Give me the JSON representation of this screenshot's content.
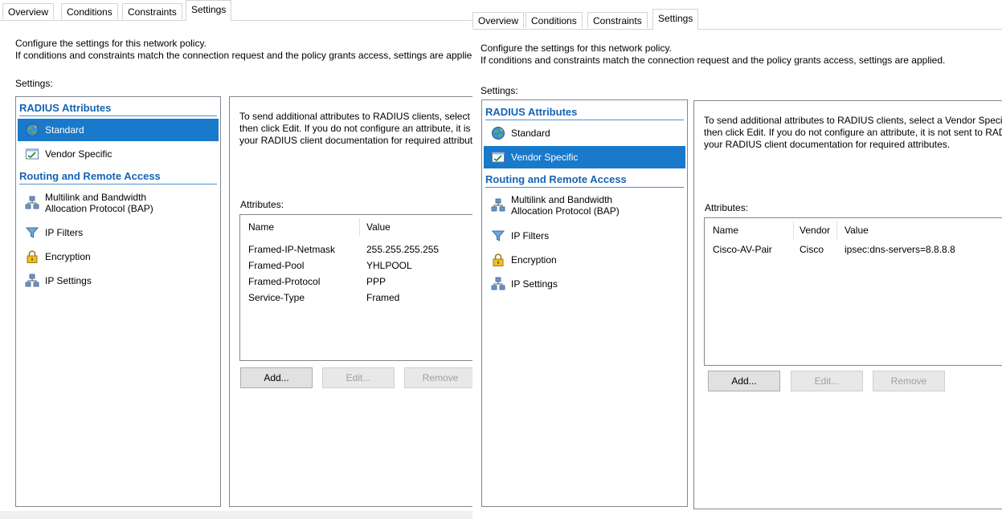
{
  "tabs": [
    "Overview",
    "Conditions",
    "Constraints",
    "Settings"
  ],
  "description": {
    "line1": "Configure the settings for this network policy.",
    "line2": "If conditions and constraints match the connection request and the policy grants access, settings are applied."
  },
  "settings_label": "Settings:",
  "nav": {
    "group_radius": "RADIUS Attributes",
    "standard": "Standard",
    "vendor_specific": "Vendor Specific",
    "group_rras": "Routing and Remote Access",
    "multilink_line1": "Multilink and Bandwidth",
    "multilink_line2": "Allocation Protocol (BAP)",
    "ip_filters": "IP Filters",
    "encryption": "Encryption",
    "ip_settings": "IP Settings"
  },
  "left_panel": {
    "selected": "Standard",
    "info_line1": "To send additional attributes to RADIUS clients, select a RADIUS standard attribute, and",
    "info_line2": "then click Edit. If you do not configure an attribute, it is not sent to RADIUS clients. See",
    "info_line3": "your RADIUS client documentation for required attributes.",
    "attributes_label": "Attributes:",
    "columns": [
      "Name",
      "Value"
    ],
    "rows": [
      {
        "name": "Framed-IP-Netmask",
        "value": "255.255.255.255"
      },
      {
        "name": "Framed-Pool",
        "value": "YHLPOOL"
      },
      {
        "name": "Framed-Protocol",
        "value": "PPP"
      },
      {
        "name": "Service-Type",
        "value": "Framed"
      }
    ],
    "buttons": {
      "add": "Add...",
      "edit": "Edit...",
      "remove": "Remove"
    }
  },
  "right_panel": {
    "selected": "Vendor Specific",
    "info_line1": "To send additional attributes to RADIUS clients, select a Vendor Specific attribute, and",
    "info_line2": "then click Edit. If you do not configure an attribute, it is not sent to RADIUS clients. See",
    "info_line3": "your RADIUS client documentation for required attributes.",
    "attributes_label": "Attributes:",
    "columns": [
      "Name",
      "Vendor",
      "Value"
    ],
    "rows": [
      {
        "name": "Cisco-AV-Pair",
        "vendor": "Cisco",
        "value": "ipsec:dns-servers=8.8.8.8"
      }
    ],
    "buttons": {
      "add": "Add...",
      "edit": "Edit...",
      "remove": "Remove"
    }
  },
  "colors": {
    "selection": "#1979ca",
    "group_header": "#1464b4",
    "border": "#828790"
  },
  "icons": [
    "globe-icon",
    "vendor-icon",
    "network-icon",
    "filter-icon",
    "lock-icon"
  ]
}
